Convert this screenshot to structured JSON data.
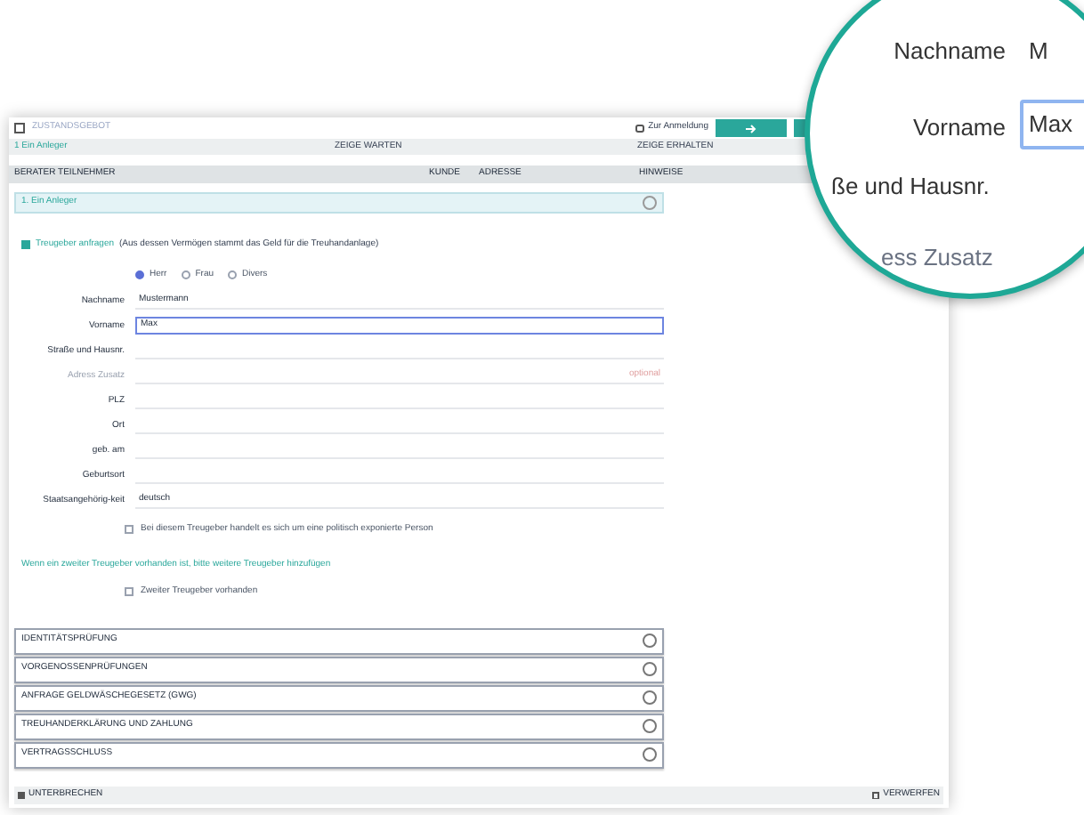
{
  "header": {
    "logo": "ZUSTANDSGEBOT",
    "link": "Zur Anmeldung"
  },
  "steps_bar": {
    "left": "1 Ein Anleger",
    "middle": "ZEIGE WARTEN",
    "right": "ZEIGE ERHALTEN"
  },
  "sub_bar": {
    "left": "BERATER TEILNEHMER",
    "middle_1": "KUNDE",
    "middle_2": "ADRESSE",
    "right": "HINWEISE"
  },
  "section": {
    "title": "1. Ein Anleger",
    "expanded": true
  },
  "intro_check": {
    "label": "Treugeber anfragen",
    "note": "(Aus dessen Vermögen stammt das Geld für die Treuhandanlage)",
    "checked": true
  },
  "salutation": [
    {
      "label": "Herr",
      "selected": true
    },
    {
      "label": "Frau",
      "selected": false
    },
    {
      "label": "Divers",
      "selected": false
    }
  ],
  "fields": [
    {
      "label": "Nachname",
      "value": "Mustermann",
      "focused": false
    },
    {
      "label": "Vorname",
      "value": "Max",
      "focused": true
    },
    {
      "label": "Straße und Hausnr.",
      "focused": false
    },
    {
      "label": "Adress Zusatz",
      "placeholder": "optional",
      "focused": false
    },
    {
      "label": "PLZ",
      "focused": false
    },
    {
      "label": "Ort",
      "focused": false
    },
    {
      "label": "geb. am",
      "focused": false
    },
    {
      "label": "Geburtsort",
      "focused": false
    },
    {
      "label": "Staatsangehörig-keit",
      "value": "deutsch",
      "focused": false
    }
  ],
  "pep_check": {
    "label": "Bei diesem Treugeber handelt es sich um eine politisch exponierte Person",
    "checked": false
  },
  "second_note": "Wenn ein zweiter Treugeber vorhanden ist, bitte weitere Treugeber hinzufügen",
  "second_check": {
    "label": "Zweiter Treugeber vorhanden",
    "checked": false
  },
  "accordions": [
    {
      "title": "IDENTITÄTSPRÜFUNG",
      "expanded": false
    },
    {
      "title": "VORGENOSSENPRÜFUNGEN",
      "expanded": false
    },
    {
      "title": "ANFRAGE GELDWÄSCHEGESETZ (GWG)",
      "expanded": false
    },
    {
      "title": "TREUHANDERKLÄRUNG UND ZAHLUNG",
      "expanded": false
    },
    {
      "title": "VERTRAGSSCHLUSS",
      "expanded": false
    }
  ],
  "footer": {
    "left": "UNTERBRECHEN",
    "right": "VERWERFEN"
  },
  "magnifier": {
    "rows": [
      {
        "label": "Nachname",
        "value": "M",
        "kind": "text"
      },
      {
        "label": "Vorname",
        "value": "Max",
        "kind": "input"
      },
      {
        "label": "ße und Hausnr.",
        "kind": "cut"
      },
      {
        "label": "ess Zusatz",
        "kind": "cut"
      }
    ]
  }
}
